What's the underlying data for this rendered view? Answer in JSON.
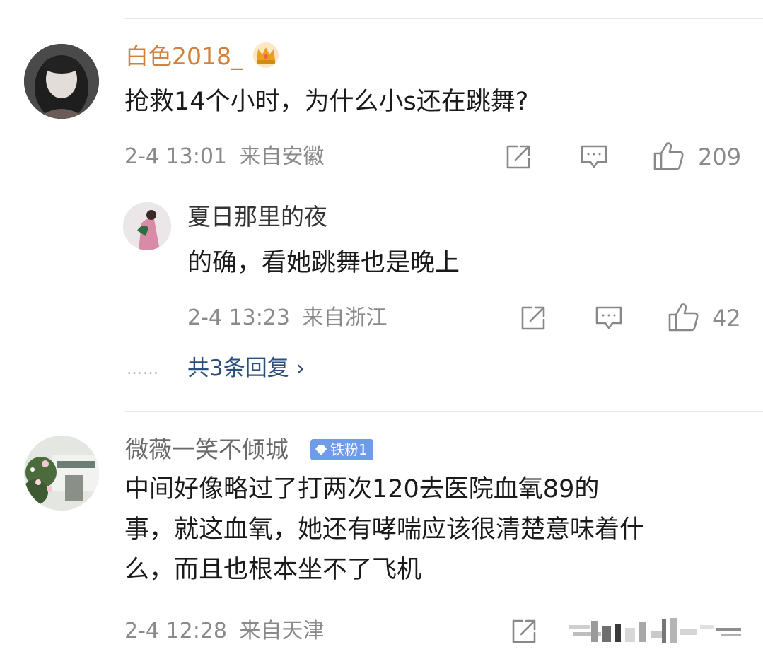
{
  "comments": [
    {
      "username": "白色2018_",
      "name_color": "#d4803a",
      "text": "抢救14个小时，为什么小s还在跳舞?",
      "time": "2-4 13:01",
      "location": "来自安徽",
      "likes": "209",
      "icons": [
        "share-icon",
        "comment-icon",
        "like-icon"
      ],
      "replies": [
        {
          "username": "夏日那里的夜",
          "text": "的确，看她跳舞也是晚上",
          "time": "2-4 13:23",
          "location": "来自浙江",
          "likes": "42"
        }
      ],
      "more_replies": "共3条回复 ›",
      "more_dots": "……"
    },
    {
      "username": "微薇一笑不倾城",
      "name_color": "#6a6a6a",
      "badge": "铁粉1",
      "badge_color": "#6f9ce8",
      "text_lines": [
        "中间好像略过了打两次120去医院血氧89的",
        "事，就这血氧，她还有哮喘应该很清楚意味着什",
        "么，而且也根本坐不了飞机"
      ],
      "time": "2-4 12:28",
      "location": "来自天津"
    }
  ]
}
